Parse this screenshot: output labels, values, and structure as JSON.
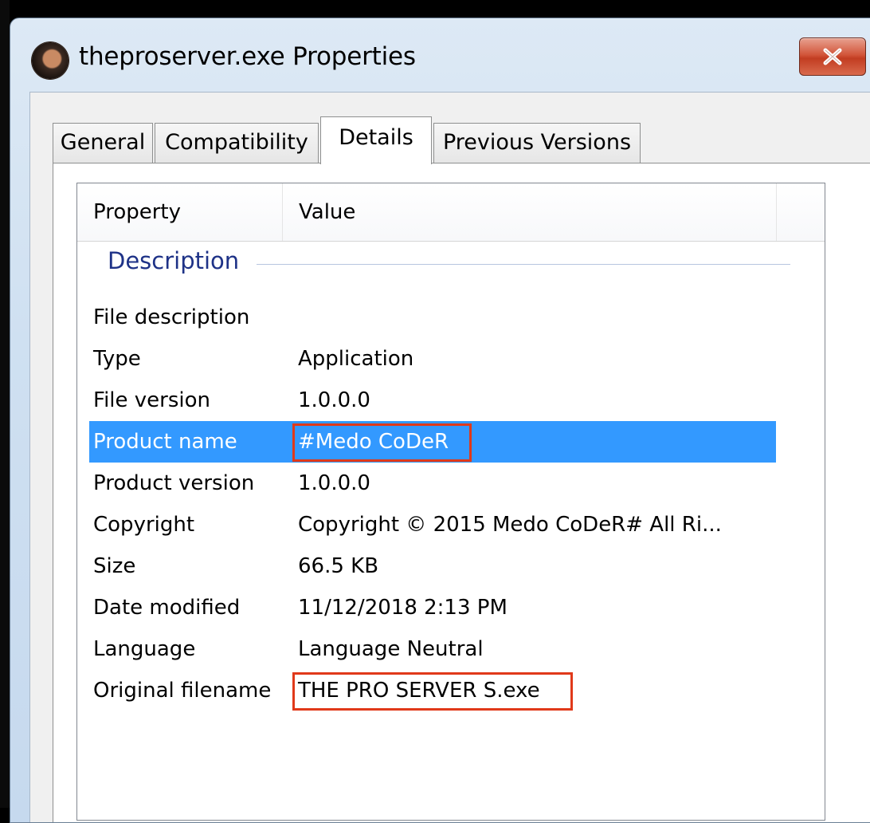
{
  "window": {
    "title": "theproserver.exe Properties",
    "close_label": "✕"
  },
  "tabs": [
    {
      "label": "General",
      "active": false
    },
    {
      "label": "Compatibility",
      "active": false
    },
    {
      "label": "Details",
      "active": true
    },
    {
      "label": "Previous Versions",
      "active": false
    }
  ],
  "listview": {
    "columns": [
      "Property",
      "Value"
    ],
    "group_label": "Description",
    "rows": [
      {
        "property": "File description",
        "value": ""
      },
      {
        "property": "Type",
        "value": "Application"
      },
      {
        "property": "File version",
        "value": "1.0.0.0"
      },
      {
        "property": "Product name",
        "value": "#Medo CoDeR",
        "selected": true,
        "highlighted": true
      },
      {
        "property": "Product version",
        "value": "1.0.0.0"
      },
      {
        "property": "Copyright",
        "value": "Copyright © 2015 Medo CoDeR# All Ri..."
      },
      {
        "property": "Size",
        "value": "66.5 KB"
      },
      {
        "property": "Date modified",
        "value": "11/12/2018 2:13 PM"
      },
      {
        "property": "Language",
        "value": "Language Neutral"
      },
      {
        "property": "Original filename",
        "value": "THE PRO SERVER S.exe",
        "highlighted": true
      }
    ]
  },
  "colors": {
    "selection": "#3399ff",
    "highlight_box": "#e0391a",
    "group_text": "#1e3287"
  }
}
